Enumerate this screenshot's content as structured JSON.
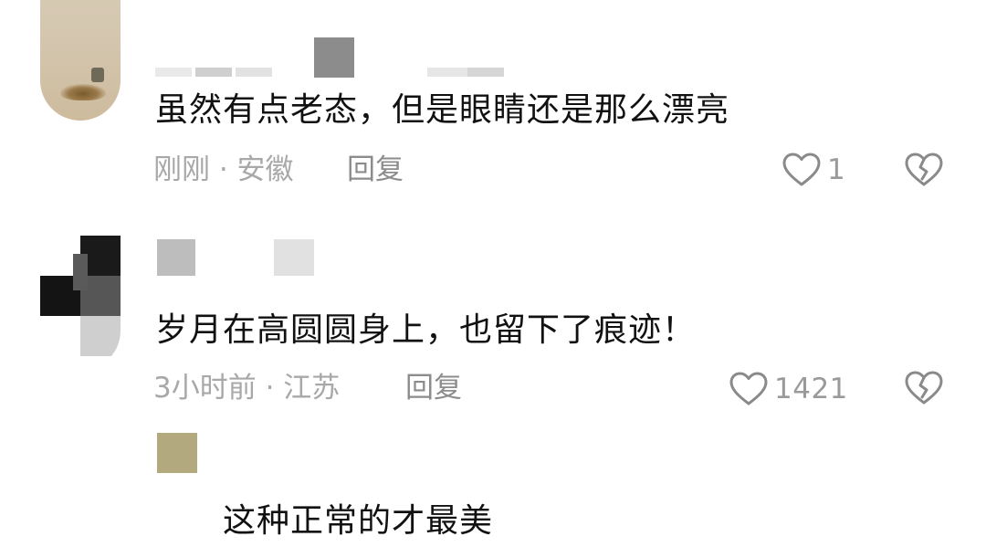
{
  "comments": [
    {
      "text": "虽然有点老态，但是眼睛还是那么漂亮",
      "meta": "刚刚 · 安徽",
      "reply_label": "回复",
      "likes": "1"
    },
    {
      "text": "岁月在高圆圆身上，也留下了痕迹！",
      "meta": "3小时前 · 江苏",
      "reply_label": "回复",
      "likes": "1421"
    }
  ],
  "reply": {
    "text": "这种正常的才最美"
  },
  "icons": {
    "like": "heart-outline-icon",
    "dislike": "broken-heart-icon"
  },
  "colors": {
    "text": "#111111",
    "meta": "#a8a8a8",
    "icon": "#8a8a8a"
  }
}
